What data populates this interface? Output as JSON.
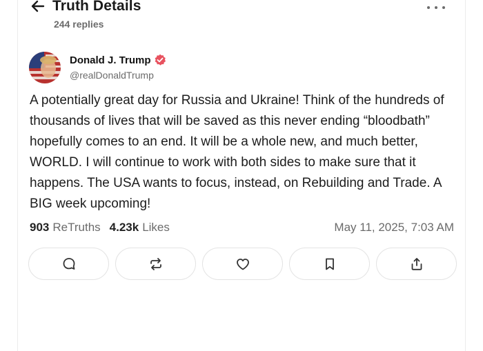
{
  "header": {
    "title": "Truth Details",
    "replies": "244 replies"
  },
  "post": {
    "author_name": "Donald J. Trump",
    "author_handle": "@realDonaldTrump",
    "text": "A potentially great day for Russia and Ukraine! Think of the hundreds of thousands of lives that will be saved as this never ending “bloodbath” hopefully comes to an end. It will be a whole new, and much better, WORLD. I will continue to work with both sides to make sure that it happens. The USA wants to focus, instead, on Rebuilding and Trade. A BIG week upcoming!",
    "retruths_count": "903",
    "retruths_label": "ReTruths",
    "likes_count": "4.23k",
    "likes_label": "Likes",
    "timestamp": "May 11, 2025, 7:03 AM"
  },
  "icons": {
    "back": "arrow-left-icon",
    "more": "more-horizontal-icon",
    "verified": "verified-badge-icon",
    "reply": "comment-icon",
    "retruth": "repost-icon",
    "like": "heart-icon",
    "bookmark": "bookmark-icon",
    "share": "share-icon"
  },
  "colors": {
    "verified_badge": "#e8525f",
    "text_primary": "#111111",
    "text_secondary": "#6b6b6b",
    "border": "#e3e3e3"
  }
}
